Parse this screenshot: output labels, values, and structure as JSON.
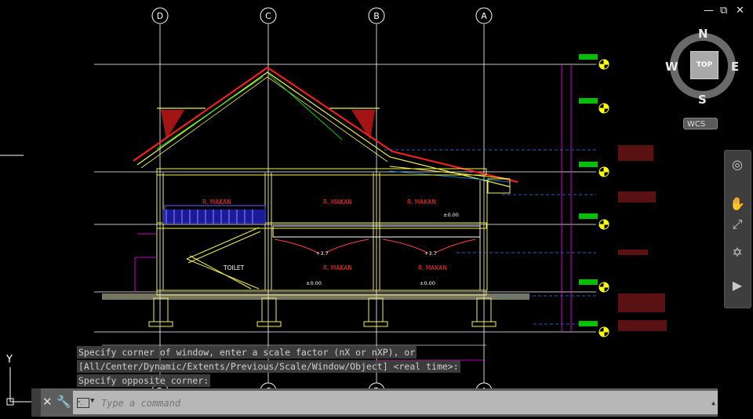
{
  "window": {
    "minimize_icon": "minimize-icon",
    "restore_icon": "restore-icon",
    "close_icon": "close-icon"
  },
  "grid_bubbles": {
    "top": [
      "D",
      "C",
      "B",
      "A"
    ],
    "bottom": [
      "D",
      "C",
      "B",
      "A"
    ]
  },
  "room_labels": [
    "R. MAKAN",
    "R. MAKAN",
    "R. MAKAN",
    "TOILET",
    "R. MAKAN",
    "R. MAKAN"
  ],
  "level_marks": [
    "±0.00",
    "+3.7",
    "+3.7",
    "±0.00",
    "±0.00"
  ],
  "viewcube": {
    "north": "N",
    "south": "S",
    "east": "E",
    "west": "W",
    "face": "TOP",
    "wcs": "WCS"
  },
  "command_history": [
    "Specify corner of window, enter a scale factor (nX or nXP), or",
    "[All/Center/Dynamic/Extents/Previous/Scale/Window/Object] <real time>:",
    "Specify opposite corner:"
  ],
  "command_input": {
    "placeholder": "Type a command"
  },
  "ucs": {
    "y_label": "Y",
    "x_label": "X"
  },
  "colors": {
    "background": "#000000",
    "gridline": "#ffffff",
    "structure": "#f0f04a",
    "roof": "#ff2020",
    "dimension": "#ff00ff",
    "annotation": "#00a0ff",
    "level": "#00ff00",
    "label_red": "#ff3030"
  }
}
